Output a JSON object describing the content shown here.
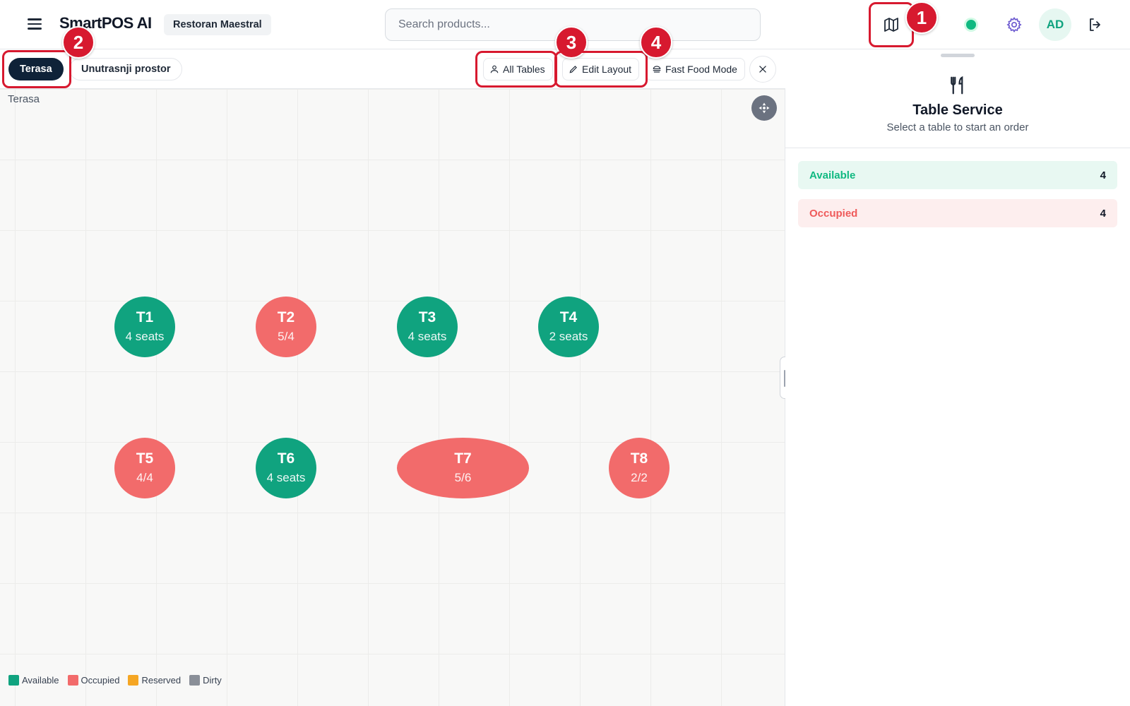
{
  "header": {
    "app_title": "SmartPOS AI",
    "restaurant": "Restoran Maestral",
    "search_placeholder": "Search products...",
    "avatar_initials": "AD"
  },
  "markers": [
    "1",
    "2",
    "3",
    "4"
  ],
  "toolbar": {
    "floor_tabs": [
      {
        "label": "Terasa",
        "active": true
      },
      {
        "label": "Unutrasnji prostor",
        "active": false
      }
    ],
    "all_tables_label": "All Tables",
    "edit_layout_label": "Edit Layout",
    "fast_food_label": "Fast Food Mode"
  },
  "floor": {
    "area_label": "Terasa",
    "tables": [
      {
        "name": "T1",
        "sub": "4 seats",
        "status": "available"
      },
      {
        "name": "T2",
        "sub": "5/4",
        "status": "occupied"
      },
      {
        "name": "T3",
        "sub": "4 seats",
        "status": "available"
      },
      {
        "name": "T4",
        "sub": "2 seats",
        "status": "available"
      },
      {
        "name": "T5",
        "sub": "4/4",
        "status": "occupied"
      },
      {
        "name": "T6",
        "sub": "4 seats",
        "status": "available"
      },
      {
        "name": "T7",
        "sub": "5/6",
        "status": "occupied"
      },
      {
        "name": "T8",
        "sub": "2/2",
        "status": "occupied"
      }
    ],
    "legend": [
      {
        "label": "Available",
        "color": "#10a37f"
      },
      {
        "label": "Occupied",
        "color": "#f26b6b"
      },
      {
        "label": "Reserved",
        "color": "#f5a623"
      },
      {
        "label": "Dirty",
        "color": "#8a8f98"
      }
    ]
  },
  "panel": {
    "title": "Table Service",
    "subtitle": "Select a table to start an order",
    "stats": [
      {
        "label": "Available",
        "count": "4",
        "color": "#10b981",
        "bg": "#e8f8f2"
      },
      {
        "label": "Occupied",
        "count": "4",
        "color": "#ef5a5a",
        "bg": "#fdeeee"
      }
    ]
  },
  "colors": {
    "available": "#10a37f",
    "occupied": "#f26b6b",
    "marker": "#d7192f",
    "active_tab": "#0f2238"
  }
}
